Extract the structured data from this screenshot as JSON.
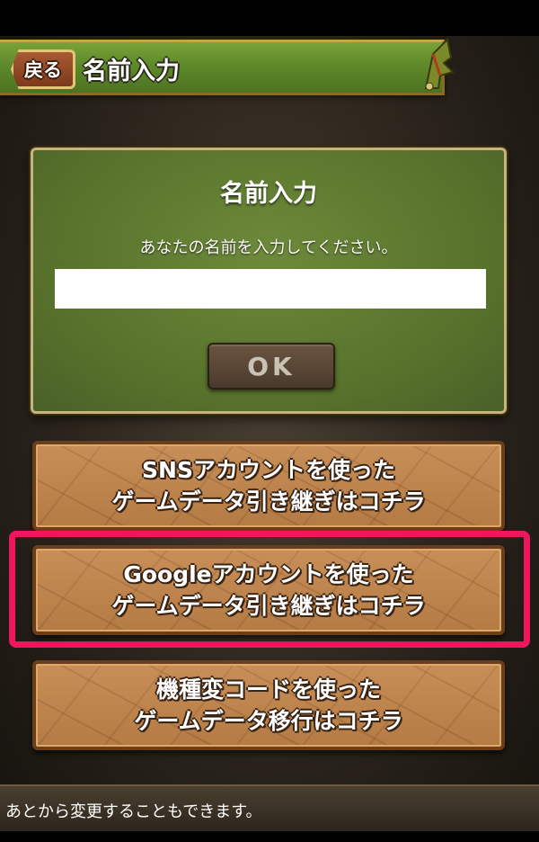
{
  "header": {
    "back_label": "戻る",
    "title": "名前入力",
    "icon": "dragon-wing-icon"
  },
  "dialog": {
    "title": "名前入力",
    "message": "あなたの名前を入力してください。",
    "input_value": "",
    "ok_label": "OK"
  },
  "buttons": [
    {
      "line1": "SNSアカウントを使った",
      "line2": "ゲームデータ引き継ぎはコチラ"
    },
    {
      "line1": "Googleアカウントを使った",
      "line2": "ゲームデータ引き継ぎはコチラ"
    },
    {
      "line1": "機種変コードを使った",
      "line2": "ゲームデータ移行はコチラ"
    }
  ],
  "footer": {
    "note": "あとから変更することもできます。"
  },
  "colors": {
    "header_green": "#5f8a2a",
    "dialog_green": "#55702a",
    "stone": "#c4854a",
    "highlight": "#f0165e"
  }
}
